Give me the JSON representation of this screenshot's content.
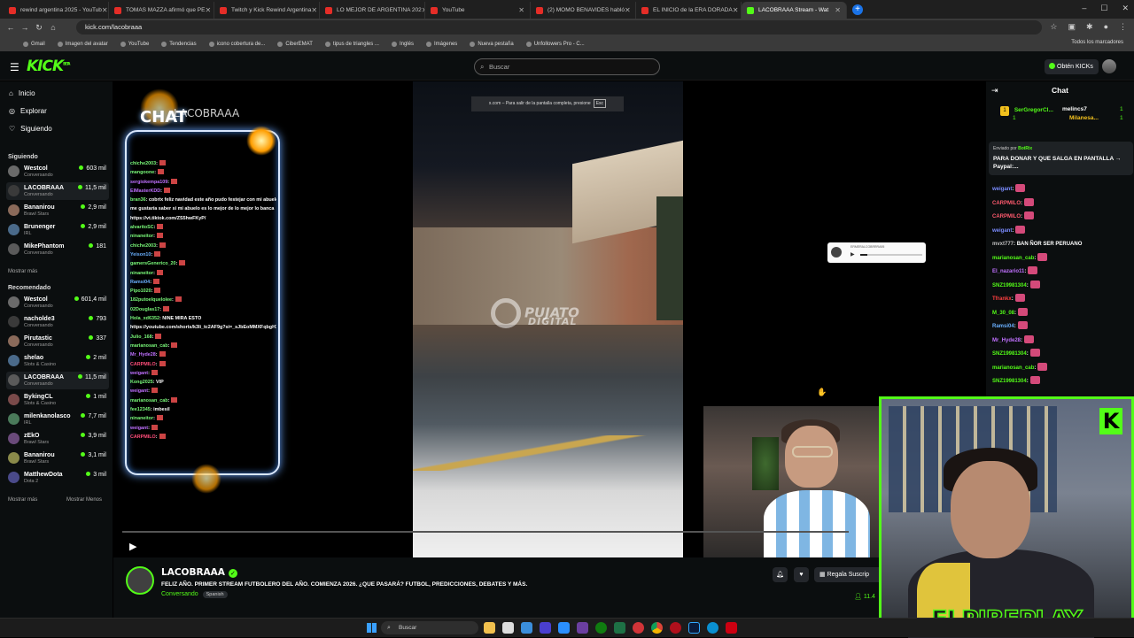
{
  "browser": {
    "tabs": [
      {
        "title": "rewind argentina 2025 - YouTub",
        "favicon": "youtube-icon"
      },
      {
        "title": "TOMAS MAZZA afirmó que PE",
        "favicon": "youtube-icon"
      },
      {
        "title": "Twitch y Kick Rewind Argentina",
        "favicon": "youtube-icon"
      },
      {
        "title": "LO MEJOR DE ARGENTINA 202",
        "favicon": "youtube-icon"
      },
      {
        "title": "YouTube",
        "favicon": "youtube-icon"
      },
      {
        "title": "(2) MOMO BENAVIDES habló",
        "favicon": "youtube-icon"
      },
      {
        "title": "EL INICIO de la ERA DORADA",
        "favicon": "youtube-icon"
      },
      {
        "title": "LACOBRAAA Stream - Wat",
        "favicon": "kick-icon",
        "active": true
      }
    ],
    "url": "kick.com/lacobraaa",
    "bookmarks": [
      "Gmail",
      "Imagen del avatar",
      "YouTube",
      "Tendencias",
      "icono cobertura de...",
      "CiberEMAT",
      "tipus de triangles ...",
      "Inglés",
      "Imágenes",
      "Nueva pestaña",
      "Unfollowers Pro - C..."
    ],
    "bookmarks_right": "Todos los marcadores"
  },
  "kick": {
    "logo": "KICK",
    "logo_badge": "BETA",
    "search_placeholder": "Buscar",
    "get_kicks": "Obtén KICKs"
  },
  "sidebar": {
    "nav": [
      {
        "label": "Inicio",
        "icon": "home-icon"
      },
      {
        "label": "Explorar",
        "icon": "compass-icon"
      },
      {
        "label": "Siguiendo",
        "icon": "heart-icon"
      }
    ],
    "following_title": "Siguiendo",
    "following": [
      {
        "name": "Westcol",
        "sub": "Conversando",
        "viewers": "603 mil"
      },
      {
        "name": "LACOBRAAA",
        "sub": "Conversando",
        "viewers": "11,5 mil"
      },
      {
        "name": "Bananirou",
        "sub": "Brawl Stars",
        "viewers": "2,9 mil"
      },
      {
        "name": "Brunenger",
        "sub": "IRL",
        "viewers": "2,9 mil"
      },
      {
        "name": "MikePhantom",
        "sub": "Conversando",
        "viewers": "181"
      }
    ],
    "show_more_1": "Mostrar más",
    "recommended_title": "Recomendado",
    "recommended": [
      {
        "name": "Westcol",
        "sub": "Conversando",
        "viewers": "601,4 mil"
      },
      {
        "name": "nacholde3",
        "sub": "Conversando",
        "viewers": "793"
      },
      {
        "name": "Pirutastic",
        "sub": "Conversando",
        "viewers": "337"
      },
      {
        "name": "shelao",
        "sub": "Slots & Casino",
        "viewers": "2 mil"
      },
      {
        "name": "LACOBRAAA",
        "sub": "Conversando",
        "viewers": "11,5 mil"
      },
      {
        "name": "BykingCL",
        "sub": "Slots & Casino",
        "viewers": "1 mil"
      },
      {
        "name": "milenkanolasco",
        "sub": "IRL",
        "viewers": "7,7 mil"
      },
      {
        "name": "zEkO",
        "sub": "Brawl Stars",
        "viewers": "3,9 mil"
      },
      {
        "name": "Bananirou",
        "sub": "Brawl Stars",
        "viewers": "3,1 mil"
      },
      {
        "name": "MatthewDota",
        "sub": "Dota 2",
        "viewers": "3 mil"
      }
    ],
    "show_more_2": "Mostrar más",
    "show_less": "Mostrar Menos"
  },
  "overlay": {
    "chat_title": "CHAT",
    "chat_handle": "LACOBRAAA",
    "messages": [
      {
        "user": "chiche2003",
        "text": ":",
        "color": "u"
      },
      {
        "user": "mangoone",
        "text": ":",
        "color": "u"
      },
      {
        "user": "sergiokempa109",
        "text": ":",
        "color": "p"
      },
      {
        "user": "ElMasterKDD",
        "text": ":",
        "color": "p"
      },
      {
        "user": "bran36",
        "text": ": cobrix feliz navidad este año pudo festejar con mi abuelo",
        "color": "u"
      },
      {
        "user": "",
        "text": "me gustaría saber si mi abuelo es lo mejor de lo mejor lo banca",
        "color": "u"
      },
      {
        "user": "",
        "text": "https://vt.tiktok.com/ZS5hwFKyP/",
        "color": "u"
      },
      {
        "user": "alvaritoSC",
        "text": ":",
        "color": "u"
      },
      {
        "user": "ninaneitor",
        "text": ":",
        "color": "u"
      },
      {
        "user": "chiche2003",
        "text": ":",
        "color": "u"
      },
      {
        "user": "Yeison10",
        "text": ":",
        "color": "b"
      },
      {
        "user": "gamersGenerico_20",
        "text": ":",
        "color": "u"
      },
      {
        "user": "ninaneitor",
        "text": ":",
        "color": "u"
      },
      {
        "user": "Ramsi04",
        "text": ":",
        "color": "b"
      },
      {
        "user": "Pipo1020",
        "text": ":",
        "color": "u"
      },
      {
        "user": "182putoelquelolee",
        "text": ":",
        "color": "u"
      },
      {
        "user": "02Douglas17",
        "text": ":",
        "color": "u"
      },
      {
        "user": "Hola_xd6352",
        "text": ": NINE MIRA ESTO",
        "color": "u"
      },
      {
        "user": "",
        "text": "https://youtube.com/shorts/k3li_tc2AF9g?si=_sJbEoMMXFqbgH1",
        "color": "u"
      },
      {
        "user": "Julio_168",
        "text": ":",
        "color": "u"
      },
      {
        "user": "marianosan_cab",
        "text": ":",
        "color": "u"
      },
      {
        "user": "Mr_Hyde28",
        "text": ":",
        "color": "p"
      },
      {
        "user": "CARPMILO",
        "text": ":",
        "color": "r"
      },
      {
        "user": "weigant",
        "text": ":",
        "color": "p"
      },
      {
        "user": "Kong2025",
        "text": ": VIP",
        "color": "u"
      },
      {
        "user": "weigant",
        "text": ":",
        "color": "p"
      },
      {
        "user": "marianosan_cab",
        "text": ":",
        "color": "u"
      },
      {
        "user": "fee12345",
        "text": ": imbesil",
        "color": "u"
      },
      {
        "user": "ninaneitor",
        "text": ":",
        "color": "u"
      },
      {
        "user": "weigant",
        "text": ":",
        "color": "p"
      },
      {
        "user": "CARPMILO",
        "text": ":",
        "color": "r"
      }
    ],
    "esc_banner": "x.com – Para salir de la pantalla completa, presione",
    "esc_key": "Esc",
    "watermark": "PUJATO",
    "watermark_sub": "DIGITAL",
    "audio_title": "ERMERALCOBRRRA95"
  },
  "stream": {
    "channel": "LACOBRAAA",
    "title": "FELIZ AÑO. PRIMER STREAM FUTBOLERO DEL AÑO. COMIENZA 2026. ¿QUE PASARÁ? FUTBOL, PREDICCIONES, DEBATES Y MÁS.",
    "status": "Conversando",
    "language": "Spanish",
    "gift_button": "Regala Suscrip",
    "viewers": "11.4"
  },
  "chat": {
    "title": "Chat",
    "leaderboard": [
      {
        "rank": "1",
        "name": "SerGregorCl...",
        "count": "1"
      },
      {
        "name": "melincs7",
        "count": "1"
      },
      {
        "name": "Milanesa...",
        "count": "1"
      }
    ],
    "pinned_sent_by": "Enviado por",
    "pinned_user": "BotRix",
    "pinned_message": "PARA DONAR Y QUE SALGA EN PANTALLA → Paypal:...",
    "messages": [
      {
        "user": "weigant",
        "text": ":",
        "color": "#7b8cff"
      },
      {
        "user": "CARPMILO",
        "text": ":",
        "color": "#ff5a6e"
      },
      {
        "user": "CARPMILO",
        "text": ":",
        "color": "#ff5a6e"
      },
      {
        "user": "weigant",
        "text": ":",
        "color": "#7b8cff"
      },
      {
        "user": "mvxt777",
        "text": ": BAN ÑOR SER PERUANO",
        "color": "#c0c0c0"
      },
      {
        "user": "marianosan_cab",
        "text": ":",
        "color": "#53fc18"
      },
      {
        "user": "El_nazario11",
        "text": ":",
        "color": "#c070ff"
      },
      {
        "user": "SNZ19981304",
        "text": ":",
        "color": "#53fc18"
      },
      {
        "user": "Tfrankx",
        "text": ":",
        "color": "#ff4040"
      },
      {
        "user": "M_30_08",
        "text": ":",
        "color": "#53fc18"
      },
      {
        "user": "Ramsi04",
        "text": ":",
        "color": "#6ab0ff"
      },
      {
        "user": "Mr_Hyde28",
        "text": ":",
        "color": "#c070ff"
      },
      {
        "user": "SNZ19981304",
        "text": ":",
        "color": "#53fc18"
      },
      {
        "user": "marianosan_cab",
        "text": ":",
        "color": "#53fc18"
      },
      {
        "user": "SNZ19981304",
        "text": ":",
        "color": "#53fc18"
      }
    ]
  },
  "webcam_overlay": {
    "text": "ELPIBEPLAY",
    "badge": "K"
  },
  "taskbar": {
    "search_placeholder": "Buscar"
  },
  "colors": {
    "accent": "#53fc18",
    "background": "#0b0e0f"
  }
}
